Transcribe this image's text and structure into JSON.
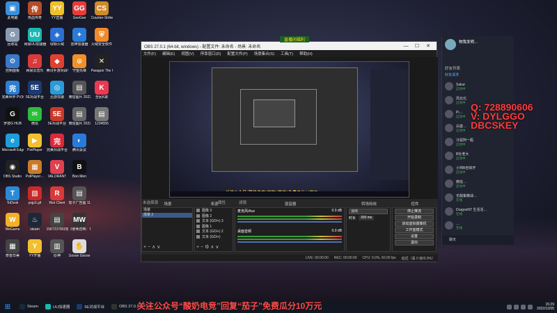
{
  "desktop": {
    "icons": [
      {
        "label": "此电脑",
        "color": "#3a8fd8",
        "glyph": "▣"
      },
      {
        "label": "热血传奇",
        "color": "#b44c2a",
        "glyph": "传"
      },
      {
        "label": "YY直播",
        "color": "#f0c02a",
        "glyph": "YY"
      },
      {
        "label": "GeeGee",
        "color": "#e63b3b",
        "glyph": "GG"
      },
      {
        "label": "Counter-Strike Global Off…",
        "color": "#d08a2a",
        "glyph": "CS"
      },
      {
        "label": "回收站",
        "color": "#8a9bb0",
        "glyph": "♻"
      },
      {
        "label": "网易UU加速器",
        "color": "#1cb7b0",
        "glyph": "UU"
      },
      {
        "label": "绿钥火绒",
        "color": "#2b6fd0",
        "glyph": "◈"
      },
      {
        "label": "雷神加速器",
        "color": "#2a7ad8",
        "glyph": "✦"
      },
      {
        "label": "火绒安全软件",
        "color": "#f08a2a",
        "glyph": "⛨"
      },
      {
        "label": "控制面板",
        "color": "#3a78c8",
        "glyph": "⚙"
      },
      {
        "label": "网易云音乐",
        "color": "#d83a3a",
        "glyph": "♫"
      },
      {
        "label": "腾讯手游对战平台",
        "color": "#e04030",
        "glyph": "◆"
      },
      {
        "label": "守望先锋",
        "color": "#f0902a",
        "glyph": "⊙"
      },
      {
        "label": "Paragon The Over…",
        "color": "#222",
        "glyph": "✕"
      },
      {
        "label": "完美世界 PV对战平台",
        "color": "#2f7fd0",
        "glyph": "完"
      },
      {
        "label": "5E对战平台",
        "color": "#1c3a70",
        "glyph": "5E"
      },
      {
        "label": "迅游加速",
        "color": "#2a9ad8",
        "glyph": "◎"
      },
      {
        "label": "微信图片 2022120…",
        "color": "#555",
        "glyph": "▤"
      },
      {
        "label": "全民K歌",
        "color": "#e83a50",
        "glyph": "K"
      },
      {
        "label": "罗技G HUB",
        "color": "#111",
        "glyph": "G"
      },
      {
        "label": "微信",
        "color": "#2cbd3c",
        "glyph": "✉"
      },
      {
        "label": "5E对战平台",
        "color": "#c83a2a",
        "glyph": "5E"
      },
      {
        "label": "微信图片 2022120…",
        "color": "#666",
        "glyph": "▤"
      },
      {
        "label": "1234556",
        "color": "#777",
        "glyph": "▤"
      },
      {
        "label": "Microsoft Edge",
        "color": "#1e9ed8",
        "glyph": "e"
      },
      {
        "label": "PotPlayer",
        "color": "#f0c030",
        "glyph": "▶"
      },
      {
        "label": "完美对战平台",
        "color": "#d82a3a",
        "glyph": "完"
      },
      {
        "label": "腾讯会议",
        "color": "#2a7ad8",
        "glyph": "◐"
      },
      {
        "label": "",
        "color": "rgba(0,0,0,0)",
        "glyph": ""
      },
      {
        "label": "OBS Studio",
        "color": "#222",
        "glyph": "◉"
      },
      {
        "label": "PotPlayer…",
        "color": "#c87a2a",
        "glyph": "▦"
      },
      {
        "label": "VALORANT",
        "color": "#e04050",
        "glyph": "V"
      },
      {
        "label": "Boo Men",
        "color": "#111",
        "glyph": "B"
      },
      {
        "label": "",
        "color": "rgba(0,0,0,0)",
        "glyph": ""
      },
      {
        "label": "ToDesk",
        "color": "#2a8ad8",
        "glyph": "T"
      },
      {
        "label": "pxjp3.gif",
        "color": "#c82a2a",
        "glyph": "▧"
      },
      {
        "label": "Riot Client",
        "color": "#d83a3a",
        "glyph": "R"
      },
      {
        "label": "茄子广告图 11.6.png",
        "color": "#555",
        "glyph": "▤"
      },
      {
        "label": "",
        "color": "rgba(0,0,0,0)",
        "glyph": ""
      },
      {
        "label": "WeGame",
        "color": "#f0b02a",
        "glyph": "W"
      },
      {
        "label": "steam",
        "color": "#1b2838",
        "glyph": "♨"
      },
      {
        "label": "1587237803茄子广告海报",
        "color": "#444",
        "glyph": "▤"
      },
      {
        "label": "《使命召唤：现代战争》…",
        "color": "#333",
        "glyph": "MW"
      },
      {
        "label": "",
        "color": "rgba(0,0,0,0)",
        "glyph": ""
      },
      {
        "label": "奇兽日美",
        "color": "#444",
        "glyph": "▦"
      },
      {
        "label": "YY开播",
        "color": "#f0c030",
        "glyph": "Y"
      },
      {
        "label": "原神",
        "color": "#555",
        "glyph": "▥"
      },
      {
        "label": "Goose Goose Duck",
        "color": "#ddd",
        "glyph": "✋"
      }
    ]
  },
  "obs": {
    "title": "OBS 27.0.1 (64-bit, windows) - 配置文件: 未命名 - 场景: 未命名",
    "minimize": "—",
    "maximize": "☐",
    "close": "✕",
    "menu": [
      "文件(F)",
      "编辑(E)",
      "视图(V)",
      "停靠窗口(D)",
      "配置文件(P)",
      "场景集合(S)",
      "工具(T)",
      "帮助(H)"
    ],
    "scene_banner": "关注公众号“酸奶电竞”回复“茄子”免费瓜分10万元",
    "source_label": "未选择源",
    "properties": "属性",
    "filters": "滤镜",
    "docks": {
      "scenes": {
        "title": "场景",
        "items": [
          "场景",
          "场景 2"
        ]
      },
      "sources": {
        "title": "来源",
        "items": [
          "图像 3",
          "图像 2",
          "文本 (GDI+) 3",
          "图像 1",
          "文本 (GDI+) 2",
          "文本 (GDI+)"
        ]
      },
      "mixer": {
        "title": "混音器",
        "tracks": [
          {
            "name": "麦克风/Aux",
            "db": "0.0 dB"
          },
          {
            "name": "桌面音频",
            "db": "0.0 dB"
          }
        ]
      },
      "transitions": {
        "title": "转场特效",
        "type": "淡出",
        "duration_label": "时长",
        "duration": "300 ms"
      },
      "controls": {
        "title": "控件",
        "buttons": [
          "停止推流",
          "开始录制",
          "启动虚拟摄像机",
          "工作室模式",
          "设置",
          "退出"
        ]
      }
    },
    "status": {
      "live": "LIVE: 00:00:00",
      "rec": "REC: 00:00:00",
      "cpu": "CPU: 0.0%, 60.00 fps",
      "dropped": "延迟（丢 0 帧/0.0%）"
    }
  },
  "overlay": {
    "sign": "直播间福利",
    "watermark_lines": [
      "Q: 728890606",
      "V: DYLGGO",
      "DBCSKEY"
    ],
    "promo": "关注公众号“酸奶电竞”回复“茄子”免费瓜分10万元"
  },
  "friends": {
    "user": "物我发明…",
    "tab": "好友列表",
    "sub": "好友请求",
    "items": [
      {
        "name": "Sakur",
        "status": "启动中"
      },
      {
        "name": "风云北",
        "status": "启动中"
      },
      {
        "name": "Pi…",
        "status": "启动中"
      },
      {
        "name": "白首…",
        "status": "启动中"
      },
      {
        "name": "冷鼠阿一瓶",
        "status": "启动中"
      },
      {
        "name": "B社老大",
        "status": "启动中"
      },
      {
        "name": "小帅B自体开",
        "status": "启动中"
      },
      {
        "name": "微信…",
        "status": "启动中"
      },
      {
        "name": "无敌紫薇战…",
        "status": "在线"
      },
      {
        "name": "DragonNT 生活活…",
        "status": "在线"
      },
      {
        "name": "…",
        "status": "在线"
      }
    ],
    "footer": "聊天"
  },
  "taskbar": {
    "items": [
      {
        "label": "Steam",
        "color": "#1b2838"
      },
      {
        "label": "UU加速器",
        "color": "#1cb7b0"
      },
      {
        "label": "5E对战平台",
        "color": "#1c3a70"
      },
      {
        "label": "OBS 27.0.1 (64-bit…",
        "color": "#333"
      }
    ],
    "time": "15:29",
    "date": "2022/12/05"
  }
}
